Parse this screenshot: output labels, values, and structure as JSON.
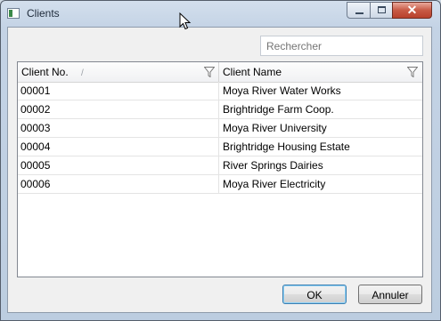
{
  "window": {
    "title": "Clients",
    "controls": {
      "minimize": "minimize-icon",
      "maximize": "maximize-icon",
      "close": "close-icon"
    }
  },
  "search": {
    "placeholder": "Rechercher",
    "value": ""
  },
  "grid": {
    "columns": [
      "Client No.",
      "Client Name"
    ],
    "sort_indicator": "/",
    "rows": [
      {
        "no": "00001",
        "name": "Moya River Water Works"
      },
      {
        "no": "00002",
        "name": "Brightridge Farm Coop."
      },
      {
        "no": "00003",
        "name": "Moya River University"
      },
      {
        "no": "00004",
        "name": "Brightridge Housing Estate"
      },
      {
        "no": "00005",
        "name": "River Springs Dairies"
      },
      {
        "no": "00006",
        "name": "Moya River Electricity"
      }
    ]
  },
  "buttons": {
    "ok": "OK",
    "cancel": "Annuler"
  },
  "colors": {
    "close_button": "#c85a45",
    "title_bar": "#c4d3e5",
    "client_area": "#f0f0f0"
  }
}
